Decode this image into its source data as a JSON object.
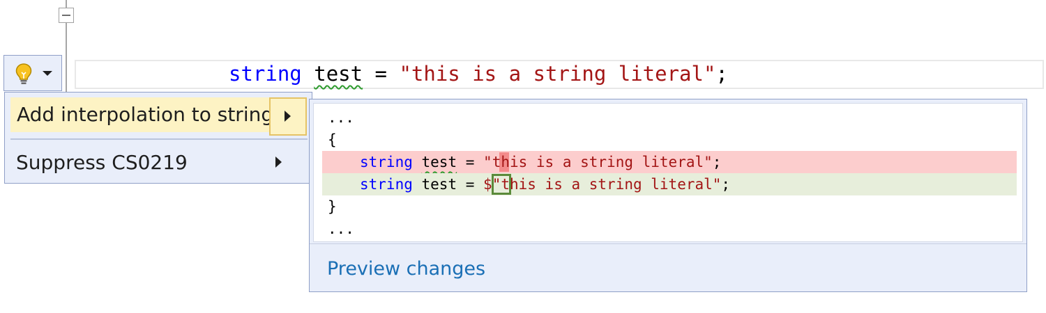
{
  "editor": {
    "code_line": {
      "keyword": "string",
      "identifier": "test",
      "op": " = ",
      "literal": "\"this is a string literal\"",
      "end": ";"
    }
  },
  "lightbulb": {
    "icon": "lightbulb-icon",
    "dropdown_icon": "chevron-down-icon"
  },
  "menu": {
    "items": [
      {
        "label": "Add interpolation to string",
        "submenu_icon": "chevron-right-icon"
      },
      {
        "label": "Suppress CS0219",
        "submenu_icon": "chevron-right-icon"
      }
    ]
  },
  "preview": {
    "lines": {
      "ellipsis_top": "...",
      "open_brace": "{",
      "removed": {
        "keyword": "string",
        "identifier": "test",
        "op": " = ",
        "literal_quote": "\"",
        "literal_rest": "this is a string literal\"",
        "end": ";"
      },
      "added": {
        "keyword": "string",
        "identifier": "test",
        "op": " = ",
        "prefix": "$",
        "literal": "\"this is a string literal\"",
        "end": ";"
      },
      "close_brace": "}",
      "ellipsis_bottom": "..."
    },
    "link": "Preview changes"
  },
  "colors": {
    "keyword": "#0000ff",
    "string": "#a31515",
    "removed_bg": "#fccdcd",
    "added_bg": "#e7eedb",
    "menu_bg": "#e9eefa",
    "highlight_bg": "#fdf3c4",
    "link": "#1a6fb5"
  }
}
